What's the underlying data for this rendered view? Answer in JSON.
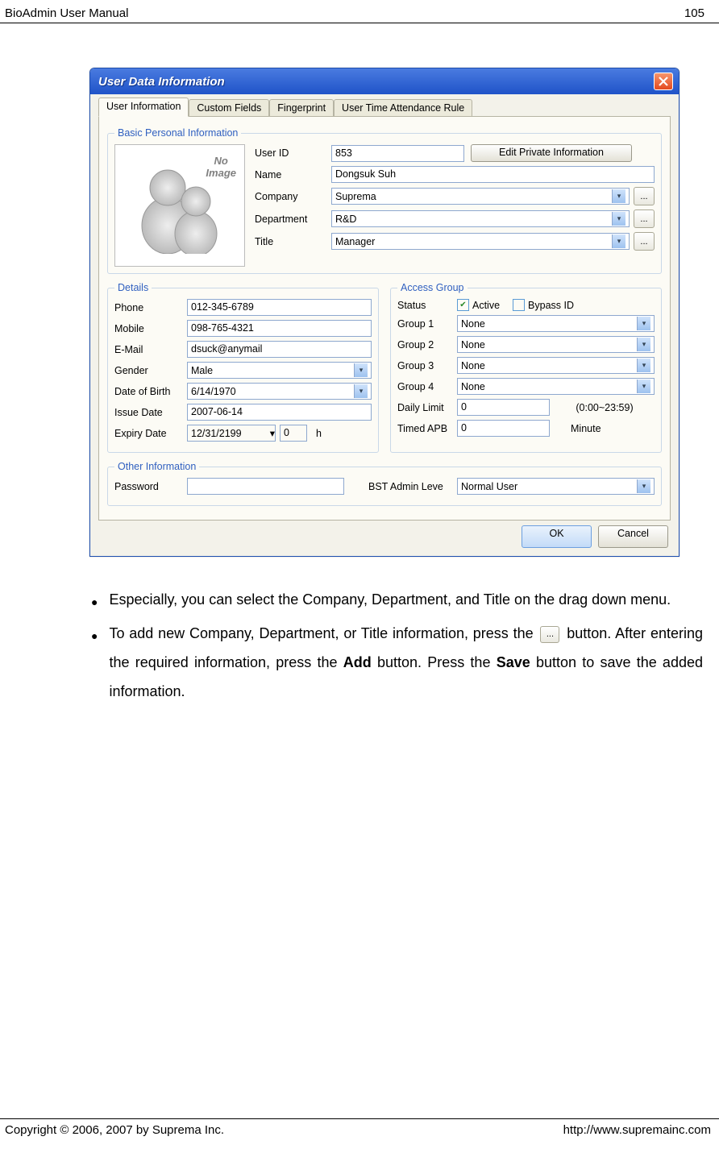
{
  "header": {
    "left": "BioAdmin  User  Manual",
    "right": "105"
  },
  "footer": {
    "left": "Copyright © 2006, 2007 by Suprema Inc.",
    "right": "http://www.supremainc.com"
  },
  "dialog": {
    "title": "User Data Information",
    "tabs": [
      "User Information",
      "Custom Fields",
      "Fingerprint",
      "User Time Attendance Rule"
    ],
    "basic": {
      "legend": "Basic Personal Information",
      "noimage": "No\nImage",
      "userid_label": "User ID",
      "userid": "853",
      "edit_btn": "Edit Private Information",
      "name_label": "Name",
      "name": "Dongsuk Suh",
      "company_label": "Company",
      "company": "Suprema",
      "dept_label": "Department",
      "dept": "R&D",
      "title_label": "Title",
      "title": "Manager",
      "dots": "..."
    },
    "details": {
      "legend": "Details",
      "phone_label": "Phone",
      "phone": "012-345-6789",
      "mobile_label": "Mobile",
      "mobile": "098-765-4321",
      "email_label": "E-Mail",
      "email": "dsuck@anymail",
      "gender_label": "Gender",
      "gender": "Male",
      "dob_label": "Date of Birth",
      "dob": " 6/14/1970",
      "issue_label": "Issue Date",
      "issue": "2007-06-14",
      "expiry_label": "Expiry Date",
      "expiry": "12/31/2199",
      "expiry_extra": "0",
      "expiry_h": "h"
    },
    "access": {
      "legend": "Access Group",
      "status_label": "Status",
      "active_label": "Active",
      "bypass_label": "Bypass ID",
      "g1_label": "Group 1",
      "g1": "None",
      "g2_label": "Group 2",
      "g2": "None",
      "g3_label": "Group 3",
      "g3": "None",
      "g4_label": "Group 4",
      "g4": "None",
      "daily_label": "Daily Limit",
      "daily": "0",
      "daily_hint": "(0:00~23:59)",
      "apb_label": "Timed APB",
      "apb": "0",
      "apb_unit": "Minute"
    },
    "other": {
      "legend": "Other Information",
      "pwd_label": "Password",
      "level_label": "BST Admin Leve",
      "level": "Normal User"
    },
    "buttons": {
      "ok": "OK",
      "cancel": "Cancel"
    }
  },
  "text": {
    "b1": "Especially, you can select the Company, Department, and Title on the drag down menu.",
    "b2_a": "To add new Company, Department, or Title information, press the ",
    "b2_b": " button. After entering the required information, press the ",
    "b2_add": "Add",
    "b2_c": " button. Press the ",
    "b2_save": "Save",
    "b2_d": " button to save the added information."
  }
}
